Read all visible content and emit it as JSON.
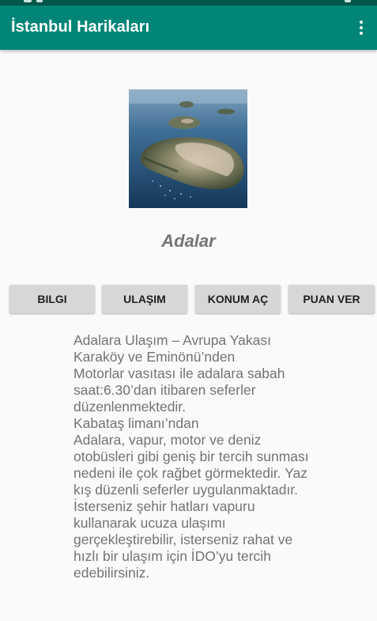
{
  "app": {
    "title": "İstanbul Harikaları"
  },
  "place": {
    "name": "Adalar",
    "image_alt": "Adalar aerial photo"
  },
  "buttons": {
    "info": "BILGI",
    "route": "ULAŞIM",
    "location": "KONUM AÇ",
    "rate": "PUAN VER"
  },
  "content": {
    "text": "Adalara Ulaşım –  Avrupa Yakası\n Karaköy ve Eminönü’nden\n Motorlar vasıtası ile adalara sabah saat:6.30’dan itibaren seferler düzenlenmektedir.\n Kabataş limanı’ndan\n Adalara, vapur, motor ve deniz otobüsleri gibi geniş bir tercih sunması nedeni ile çok rağbet görmektedir. Yaz kış düzenli seferler uygulanmaktadır. İsterseniz şehir hatları vapuru kullanarak ucuza ulaşımı gerçekleştirebilir, isterseniz rahat ve hızlı bir ulaşım için İDO’yu tercih edebilirsiniz."
  },
  "colors": {
    "appbar": "#008577",
    "statusbar": "#00574b",
    "background": "#fafafa",
    "button": "#d6d7d7",
    "text_muted": "#757575"
  }
}
